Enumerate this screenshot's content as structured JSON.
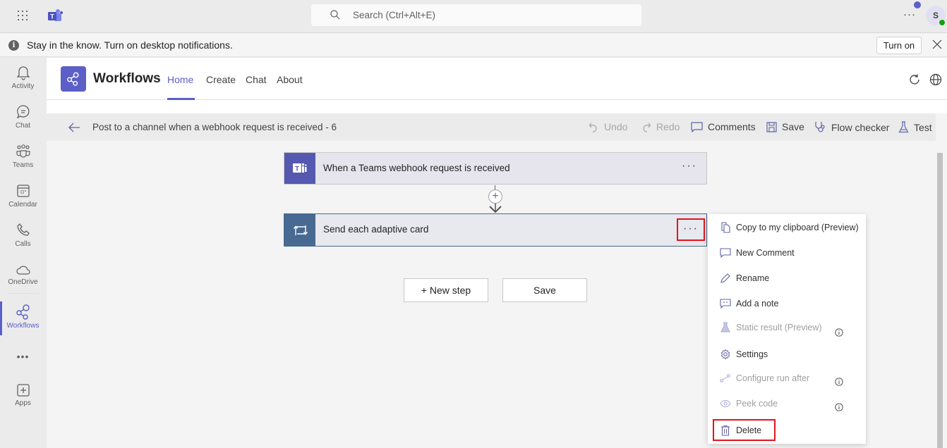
{
  "topbar": {
    "apps_icon": "waffle-grid-icon",
    "logo": "microsoft-teams-logo",
    "search_placeholder": "Search (Ctrl+Alt+E)",
    "more_label": "···",
    "avatar_initial": "S",
    "presence_status": "available"
  },
  "banner": {
    "message": "Stay in the know. Turn on desktop notifications.",
    "turn_on_label": "Turn on"
  },
  "rail": {
    "items": [
      {
        "label": "Activity",
        "icon": "bell-icon"
      },
      {
        "label": "Chat",
        "icon": "chat-icon"
      },
      {
        "label": "Teams",
        "icon": "teams-icon"
      },
      {
        "label": "Calendar",
        "icon": "calendar-icon"
      },
      {
        "label": "Calls",
        "icon": "phone-icon"
      },
      {
        "label": "OneDrive",
        "icon": "cloud-icon"
      },
      {
        "label": "Workflows",
        "icon": "workflows-icon",
        "active": true
      },
      {
        "label": "Apps",
        "icon": "add-app-icon"
      }
    ],
    "more_label": "•••"
  },
  "app": {
    "title": "Workflows",
    "tabs": [
      {
        "label": "Home",
        "active": true
      },
      {
        "label": "Create"
      },
      {
        "label": "Chat"
      },
      {
        "label": "About"
      }
    ]
  },
  "designer": {
    "flow_title": "Post to a channel when a webhook request is received - 6",
    "commands": {
      "undo": "Undo",
      "redo": "Redo",
      "comments": "Comments",
      "save": "Save",
      "flow_checker": "Flow checker",
      "test": "Test"
    },
    "steps": [
      {
        "title": "When a Teams webhook request is received",
        "icon": "teams-icon",
        "color": "#5558af"
      },
      {
        "title": "Send each adaptive card",
        "icon": "loop-icon",
        "color": "#486991"
      }
    ],
    "menu_label": "···",
    "add_step_label": "+",
    "new_step_label": "+ New step",
    "save_label": "Save"
  },
  "context_menu": {
    "items": [
      {
        "label": "Copy to my clipboard (Preview)",
        "icon": "copy-icon",
        "enabled": true
      },
      {
        "label": "New Comment",
        "icon": "comment-icon",
        "enabled": true
      },
      {
        "label": "Rename",
        "icon": "pencil-icon",
        "enabled": true
      },
      {
        "label": "Add a note",
        "icon": "note-icon",
        "enabled": true
      },
      {
        "label": "Static result (Preview)",
        "icon": "flask-icon",
        "enabled": false,
        "info": true
      },
      {
        "label": "Settings",
        "icon": "gear-icon",
        "enabled": true
      },
      {
        "label": "Configure run after",
        "icon": "run-after-icon",
        "enabled": false,
        "info": true
      },
      {
        "label": "Peek code",
        "icon": "eye-icon",
        "enabled": false,
        "info": true
      },
      {
        "label": "Delete",
        "icon": "trash-icon",
        "enabled": true,
        "highlighted": true
      }
    ]
  },
  "colors": {
    "brand": "#5b5fc7",
    "highlight": "#e3141c",
    "loop_step": "#486991",
    "teams_step": "#5558af"
  }
}
